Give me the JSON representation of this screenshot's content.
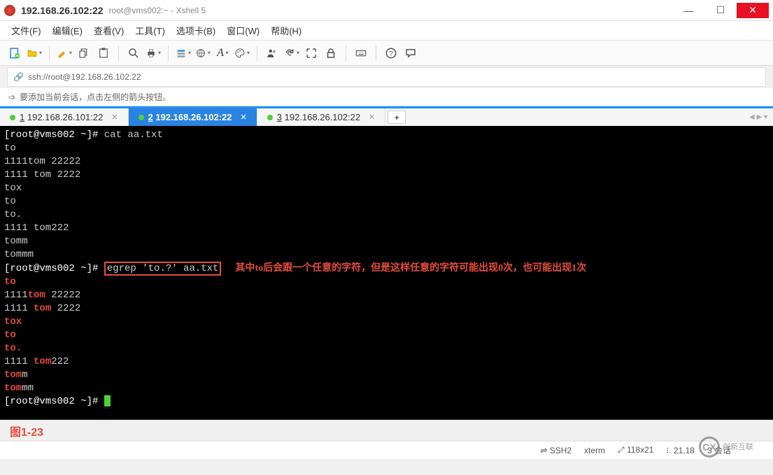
{
  "title": {
    "ip": "192.168.26.102:22",
    "sub": "root@vms002:~ - Xshell 5"
  },
  "menu": {
    "file": "文件(F)",
    "edit": "编辑(E)",
    "view": "查看(V)",
    "tools": "工具(T)",
    "tabs": "选项卡(B)",
    "window": "窗口(W)",
    "help": "帮助(H)"
  },
  "address": {
    "url": "ssh://root@192.168.26.102:22"
  },
  "hint": {
    "text": "要添加当前会话，点击左侧的箭头按钮。"
  },
  "tabs": [
    {
      "num": "1",
      "label": "192.168.26.101:22"
    },
    {
      "num": "2",
      "label": "192.168.26.102:22"
    },
    {
      "num": "3",
      "label": "192.168.26.102:22"
    }
  ],
  "terminal": {
    "prompt1": "[root@vms002 ~]# ",
    "cmd1": "cat aa.txt",
    "lines_plain": [
      "to",
      "1111tom 22222",
      "1111 tom 2222",
      "tox",
      "to",
      "to.",
      "1111 tom222",
      "tomm",
      "tommm"
    ],
    "prompt2": "[root@vms002 ~]# ",
    "cmd2": "egrep 'to.?' aa.txt",
    "annotation": "其中to后会跟一个任意的字符，但是这样任意的字符可能出现0次，也可能出现1次",
    "result": [
      {
        "segments": [
          {
            "t": "to",
            "hl": true
          }
        ]
      },
      {
        "segments": [
          {
            "t": "1111",
            "hl": false
          },
          {
            "t": "tom",
            "hl": true
          },
          {
            "t": " 22222",
            "hl": false
          }
        ]
      },
      {
        "segments": [
          {
            "t": "1111 ",
            "hl": false
          },
          {
            "t": "tom",
            "hl": true
          },
          {
            "t": " 2222",
            "hl": false
          }
        ]
      },
      {
        "segments": [
          {
            "t": "tox",
            "hl": true
          }
        ]
      },
      {
        "segments": [
          {
            "t": "to",
            "hl": true
          }
        ]
      },
      {
        "segments": [
          {
            "t": "to.",
            "hl": true
          }
        ]
      },
      {
        "segments": [
          {
            "t": "1111 ",
            "hl": false
          },
          {
            "t": "tom",
            "hl": true
          },
          {
            "t": "222",
            "hl": false
          }
        ]
      },
      {
        "segments": [
          {
            "t": "tom",
            "hl": true
          },
          {
            "t": "m",
            "hl": false
          }
        ]
      },
      {
        "segments": [
          {
            "t": "tom",
            "hl": true
          },
          {
            "t": "mm",
            "hl": false
          }
        ]
      }
    ],
    "prompt3": "[root@vms002 ~]# "
  },
  "figlabel": "图1-23",
  "status": {
    "proto": "SSH2",
    "term": "xterm",
    "size": "118x21",
    "pos": "21,18",
    "sessions": "3 会话"
  },
  "watermark": {
    "logo": "CX",
    "text": "创新互联"
  },
  "icons": {
    "newfile": "new-file-icon",
    "folder": "folder-icon",
    "paint": "highlight-icon",
    "copy": "copy-icon",
    "paste": "paste-icon",
    "search": "search-icon",
    "print": "print-icon",
    "props": "properties-icon",
    "globe": "globe-icon",
    "font": "font-icon",
    "palette": "palette-icon",
    "users": "users-icon",
    "refresh": "refresh-icon",
    "fullscreen": "fullscreen-icon",
    "lock": "lock-icon",
    "keyboard": "keyboard-icon",
    "help": "help-icon",
    "comment": "comment-icon",
    "link": "link-icon",
    "arrow": "arrow-icon"
  }
}
